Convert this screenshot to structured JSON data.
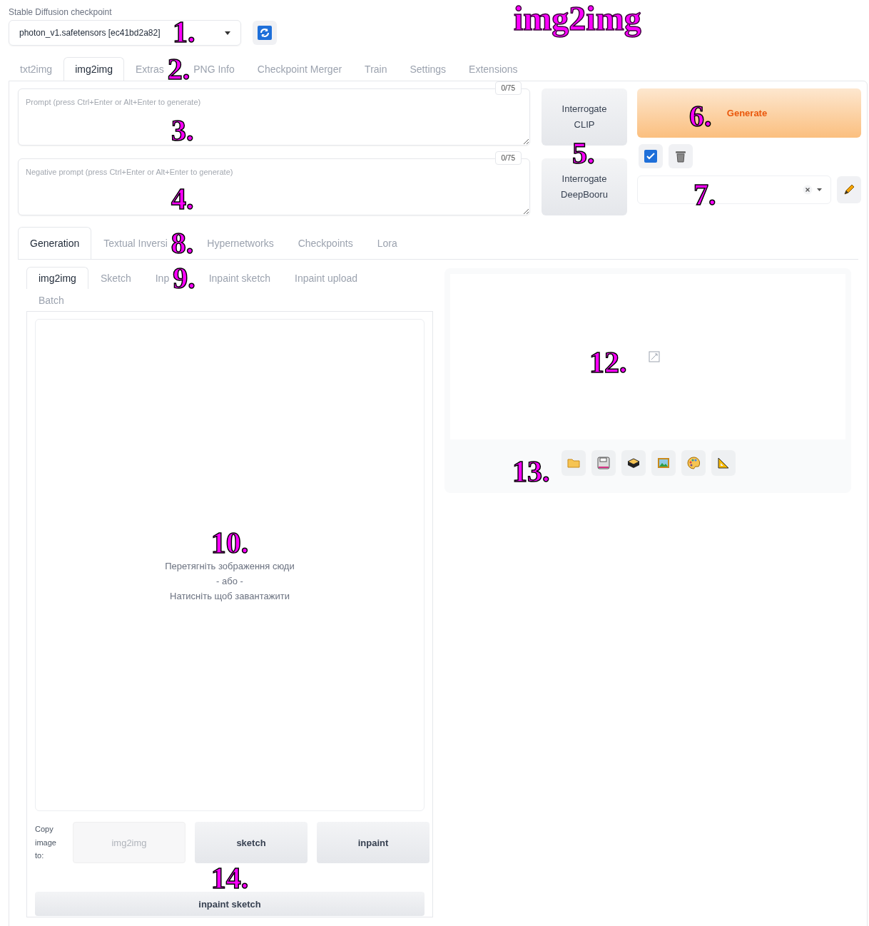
{
  "title": "img2img",
  "checkpoint": {
    "label": "Stable Diffusion checkpoint",
    "value": "photon_v1.safetensors [ec41bd2a82]",
    "marker": "1."
  },
  "main_tabs": {
    "marker": "2.",
    "items": [
      {
        "label": "txt2img",
        "selected": false
      },
      {
        "label": "img2img",
        "selected": true
      },
      {
        "label": "Extras",
        "selected": false
      },
      {
        "label": "PNG Info",
        "selected": false
      },
      {
        "label": "Checkpoint Merger",
        "selected": false
      },
      {
        "label": "Train",
        "selected": false
      },
      {
        "label": "Settings",
        "selected": false
      },
      {
        "label": "Extensions",
        "selected": false
      }
    ]
  },
  "prompt": {
    "placeholder": "Prompt (press Ctrl+Enter or Alt+Enter to generate)",
    "counter": "0/75",
    "marker": "3."
  },
  "negative_prompt": {
    "placeholder": "Negative prompt (press Ctrl+Enter or Alt+Enter to generate)",
    "counter": "0/75",
    "marker": "4."
  },
  "interrogate": {
    "marker": "5.",
    "buttons": [
      "Interrogate CLIP",
      "Interrogate DeepBooru"
    ]
  },
  "generate": {
    "label": "Generate",
    "marker": "6."
  },
  "styles": {
    "marker": "7."
  },
  "extra_tabs": {
    "marker": "8.",
    "items": [
      {
        "label": "Generation",
        "selected": true
      },
      {
        "label": "Textual Inversi",
        "selected": false
      },
      {
        "label": "Hypernetworks",
        "selected": false
      },
      {
        "label": "Checkpoints",
        "selected": false
      },
      {
        "label": "Lora",
        "selected": false
      }
    ]
  },
  "input_tabs": {
    "marker": "9.",
    "items": [
      {
        "label": "img2img",
        "selected": true
      },
      {
        "label": "Sketch",
        "selected": false
      },
      {
        "label": "Inp",
        "selected": false
      },
      {
        "label": "Inpaint sketch",
        "selected": false
      },
      {
        "label": "Inpaint upload",
        "selected": false
      },
      {
        "label": "Batch",
        "selected": false
      }
    ]
  },
  "upload": {
    "marker": "10.",
    "lines": [
      "Перетягніть зображення сюди",
      "- або -",
      "Натисніть щоб завантажити"
    ]
  },
  "gallery": {
    "marker": "12."
  },
  "gallery_tools": {
    "marker": "13."
  },
  "copy_to": {
    "marker": "14.",
    "label": "Copy image to:",
    "buttons": [
      {
        "label": "img2img",
        "disabled": true
      },
      {
        "label": "sketch",
        "disabled": false
      },
      {
        "label": "inpaint",
        "disabled": false
      },
      {
        "label": "inpaint sketch",
        "disabled": false
      }
    ]
  }
}
